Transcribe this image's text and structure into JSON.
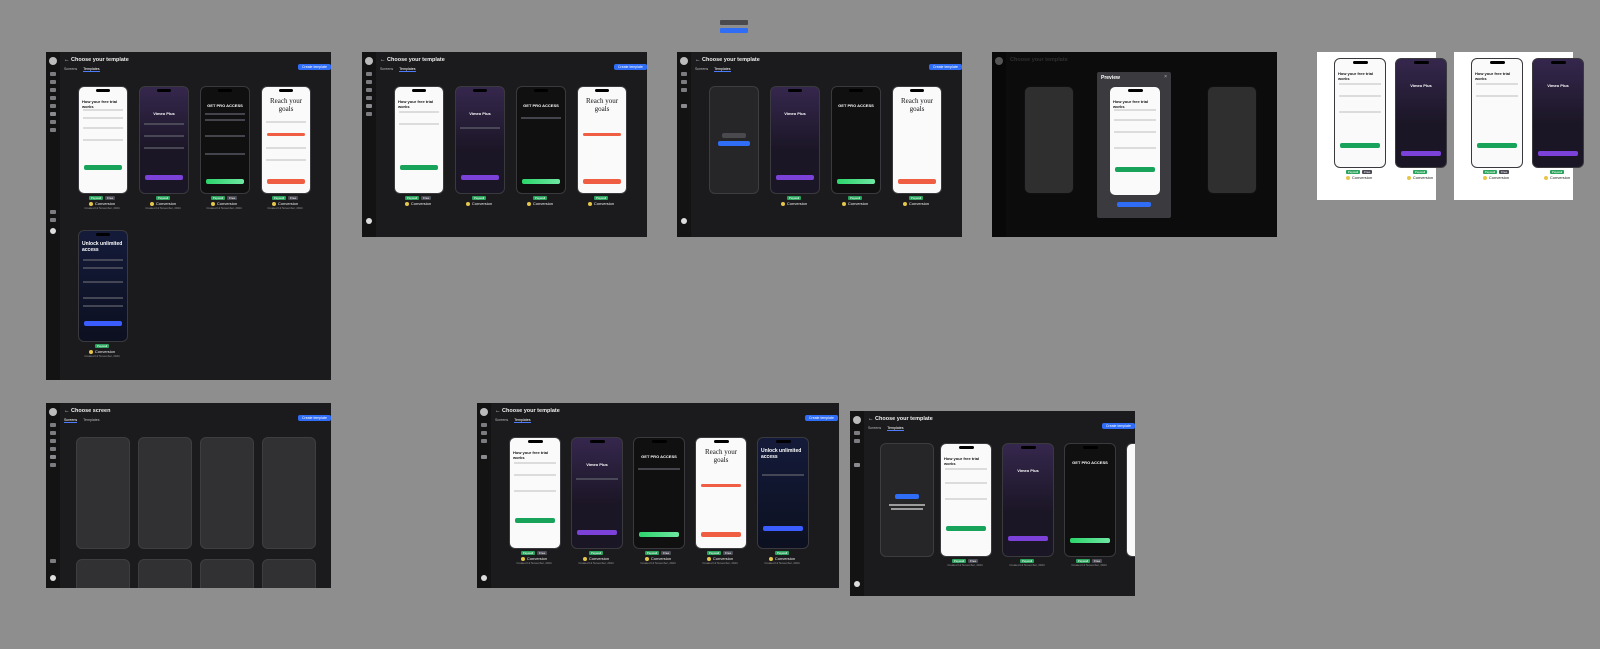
{
  "header": {
    "title": "Choose your template",
    "screen_title": "Choose screen"
  },
  "tabs": {
    "screens": "Screens",
    "templates": "Templates"
  },
  "cta": {
    "create_template": "Create template",
    "use_template": "Use this template"
  },
  "preview": {
    "title": "Preview"
  },
  "top_pills": {
    "label_1": "Preview"
  },
  "templates": [
    {
      "title": "How your free trial works",
      "tags": [
        "Paywall",
        "Free"
      ],
      "name": "Conversion",
      "date": "Created 12 November, 2024"
    },
    {
      "title": "Vimeo Plus",
      "tags": [
        "Paywall"
      ],
      "name": "Conversion",
      "date": "Created 12 November, 2024"
    },
    {
      "title": "GET PRO ACCESS",
      "tags": [
        "Paywall",
        "Free"
      ],
      "name": "Conversion",
      "date": "Created 12 November, 2024"
    },
    {
      "title": "Reach your goals",
      "tags": [
        "Paywall",
        "Free"
      ],
      "name": "Conversion",
      "date": "Created 12 November, 2024"
    },
    {
      "title": "Unlock unlimited access",
      "tags": [
        "Paywall"
      ],
      "name": "Conversion",
      "date": "Created 12 November, 2024"
    }
  ],
  "colors": {
    "bg": "#8e8e8e",
    "frame": "#1b1b1d",
    "accent": "#2f6df6",
    "green": "#18a35a",
    "purple": "#7b41d8",
    "coral": "#ef5e43"
  },
  "icons": [
    "logo-icon",
    "home-icon",
    "chart-icon",
    "send-icon",
    "settings-icon",
    "bulb-icon",
    "user-avatar-icon"
  ]
}
